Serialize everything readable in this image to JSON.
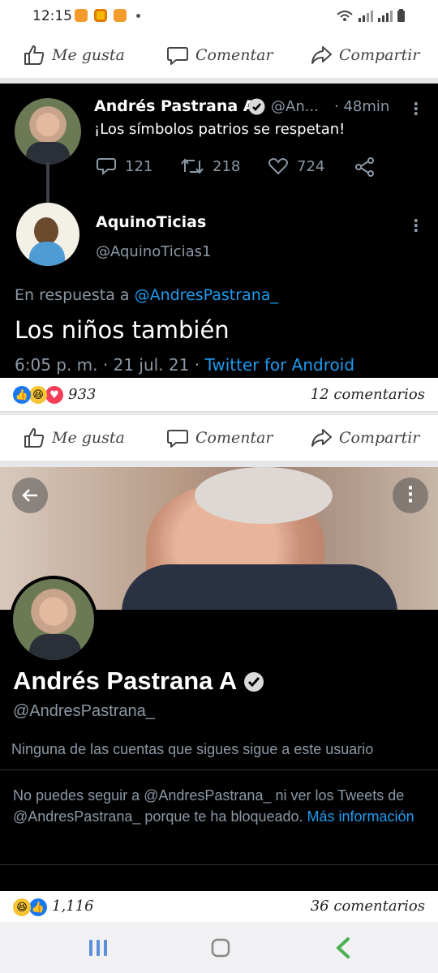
{
  "status_bar": {
    "time": "12:15"
  },
  "action_bar": {
    "like_label": "Me gusta",
    "comment_label": "Comentar",
    "share_label": "Compartir"
  },
  "tweet": {
    "author_name": "Andrés Pastrana A",
    "author_handle": "@An...",
    "time_ago": "· 48min",
    "text": "¡Los símbolos patrios se respetan!",
    "replies": "121",
    "retweets": "218",
    "likes": "724"
  },
  "reply": {
    "author_name": "AquinoTicias",
    "author_handle": "@AquinoTicias1",
    "in_reply_prefix": "En respuesta a ",
    "in_reply_handle": "@AndresPastrana_",
    "text": "Los niños también",
    "timestamp": "6:05 p. m. · 21 jul. 21 · ",
    "client": "Twitter for Android"
  },
  "post1_reactions": {
    "count": "933",
    "comments": "12 comentarios"
  },
  "profile": {
    "name": "Andrés Pastrana A",
    "handle": "@AndresPastrana_",
    "followers_note": "Ninguna de las cuentas que sigues sigue a este usuario",
    "blocked_text": "No puedes seguir a @AndresPastrana_ ni ver los Tweets de @AndresPastrana_ porque te ha bloqueado. ",
    "more_info": "Más información"
  },
  "post2_reactions": {
    "count": "1,116",
    "comments": "36 comentarios"
  },
  "colors": {
    "twitter_blue": "#1d9bf0",
    "fb_blue": "#1877f2",
    "dark_bg": "#000000",
    "muted": "#8b98a5"
  },
  "icons": [
    "like-icon",
    "comment-icon",
    "share-icon",
    "verified-icon",
    "reply-icon",
    "retweet-icon",
    "heart-icon",
    "share-tweet-icon",
    "back-icon",
    "more-icon",
    "recents-icon",
    "home-icon",
    "back-nav-icon"
  ]
}
